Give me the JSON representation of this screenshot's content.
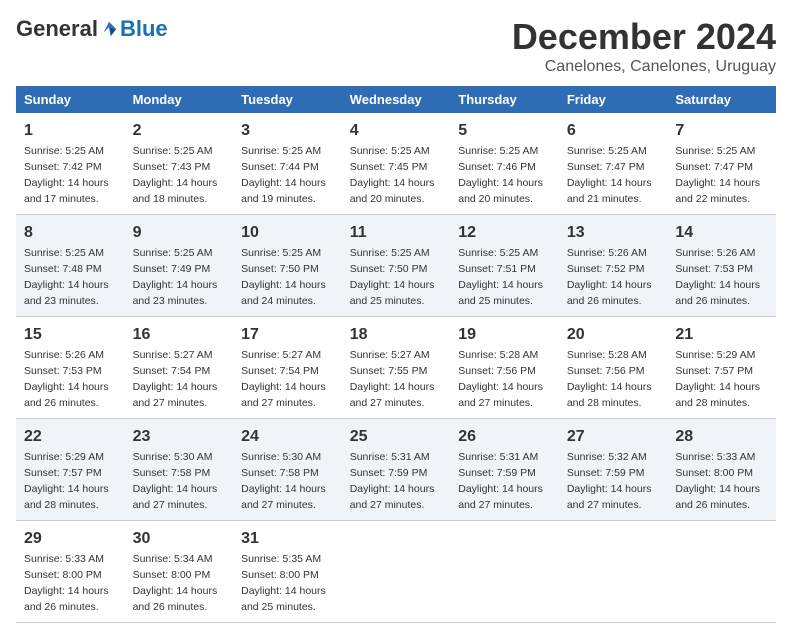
{
  "logo": {
    "general": "General",
    "blue": "Blue"
  },
  "title": "December 2024",
  "location": "Canelones, Canelones, Uruguay",
  "headers": [
    "Sunday",
    "Monday",
    "Tuesday",
    "Wednesday",
    "Thursday",
    "Friday",
    "Saturday"
  ],
  "weeks": [
    [
      {
        "day": "1",
        "sunrise": "5:25 AM",
        "sunset": "7:42 PM",
        "daylight": "14 hours and 17 minutes."
      },
      {
        "day": "2",
        "sunrise": "5:25 AM",
        "sunset": "7:43 PM",
        "daylight": "14 hours and 18 minutes."
      },
      {
        "day": "3",
        "sunrise": "5:25 AM",
        "sunset": "7:44 PM",
        "daylight": "14 hours and 19 minutes."
      },
      {
        "day": "4",
        "sunrise": "5:25 AM",
        "sunset": "7:45 PM",
        "daylight": "14 hours and 20 minutes."
      },
      {
        "day": "5",
        "sunrise": "5:25 AM",
        "sunset": "7:46 PM",
        "daylight": "14 hours and 20 minutes."
      },
      {
        "day": "6",
        "sunrise": "5:25 AM",
        "sunset": "7:47 PM",
        "daylight": "14 hours and 21 minutes."
      },
      {
        "day": "7",
        "sunrise": "5:25 AM",
        "sunset": "7:47 PM",
        "daylight": "14 hours and 22 minutes."
      }
    ],
    [
      {
        "day": "8",
        "sunrise": "5:25 AM",
        "sunset": "7:48 PM",
        "daylight": "14 hours and 23 minutes."
      },
      {
        "day": "9",
        "sunrise": "5:25 AM",
        "sunset": "7:49 PM",
        "daylight": "14 hours and 23 minutes."
      },
      {
        "day": "10",
        "sunrise": "5:25 AM",
        "sunset": "7:50 PM",
        "daylight": "14 hours and 24 minutes."
      },
      {
        "day": "11",
        "sunrise": "5:25 AM",
        "sunset": "7:50 PM",
        "daylight": "14 hours and 25 minutes."
      },
      {
        "day": "12",
        "sunrise": "5:25 AM",
        "sunset": "7:51 PM",
        "daylight": "14 hours and 25 minutes."
      },
      {
        "day": "13",
        "sunrise": "5:26 AM",
        "sunset": "7:52 PM",
        "daylight": "14 hours and 26 minutes."
      },
      {
        "day": "14",
        "sunrise": "5:26 AM",
        "sunset": "7:53 PM",
        "daylight": "14 hours and 26 minutes."
      }
    ],
    [
      {
        "day": "15",
        "sunrise": "5:26 AM",
        "sunset": "7:53 PM",
        "daylight": "14 hours and 26 minutes."
      },
      {
        "day": "16",
        "sunrise": "5:27 AM",
        "sunset": "7:54 PM",
        "daylight": "14 hours and 27 minutes."
      },
      {
        "day": "17",
        "sunrise": "5:27 AM",
        "sunset": "7:54 PM",
        "daylight": "14 hours and 27 minutes."
      },
      {
        "day": "18",
        "sunrise": "5:27 AM",
        "sunset": "7:55 PM",
        "daylight": "14 hours and 27 minutes."
      },
      {
        "day": "19",
        "sunrise": "5:28 AM",
        "sunset": "7:56 PM",
        "daylight": "14 hours and 27 minutes."
      },
      {
        "day": "20",
        "sunrise": "5:28 AM",
        "sunset": "7:56 PM",
        "daylight": "14 hours and 28 minutes."
      },
      {
        "day": "21",
        "sunrise": "5:29 AM",
        "sunset": "7:57 PM",
        "daylight": "14 hours and 28 minutes."
      }
    ],
    [
      {
        "day": "22",
        "sunrise": "5:29 AM",
        "sunset": "7:57 PM",
        "daylight": "14 hours and 28 minutes."
      },
      {
        "day": "23",
        "sunrise": "5:30 AM",
        "sunset": "7:58 PM",
        "daylight": "14 hours and 27 minutes."
      },
      {
        "day": "24",
        "sunrise": "5:30 AM",
        "sunset": "7:58 PM",
        "daylight": "14 hours and 27 minutes."
      },
      {
        "day": "25",
        "sunrise": "5:31 AM",
        "sunset": "7:59 PM",
        "daylight": "14 hours and 27 minutes."
      },
      {
        "day": "26",
        "sunrise": "5:31 AM",
        "sunset": "7:59 PM",
        "daylight": "14 hours and 27 minutes."
      },
      {
        "day": "27",
        "sunrise": "5:32 AM",
        "sunset": "7:59 PM",
        "daylight": "14 hours and 27 minutes."
      },
      {
        "day": "28",
        "sunrise": "5:33 AM",
        "sunset": "8:00 PM",
        "daylight": "14 hours and 26 minutes."
      }
    ],
    [
      {
        "day": "29",
        "sunrise": "5:33 AM",
        "sunset": "8:00 PM",
        "daylight": "14 hours and 26 minutes."
      },
      {
        "day": "30",
        "sunrise": "5:34 AM",
        "sunset": "8:00 PM",
        "daylight": "14 hours and 26 minutes."
      },
      {
        "day": "31",
        "sunrise": "5:35 AM",
        "sunset": "8:00 PM",
        "daylight": "14 hours and 25 minutes."
      },
      null,
      null,
      null,
      null
    ]
  ]
}
